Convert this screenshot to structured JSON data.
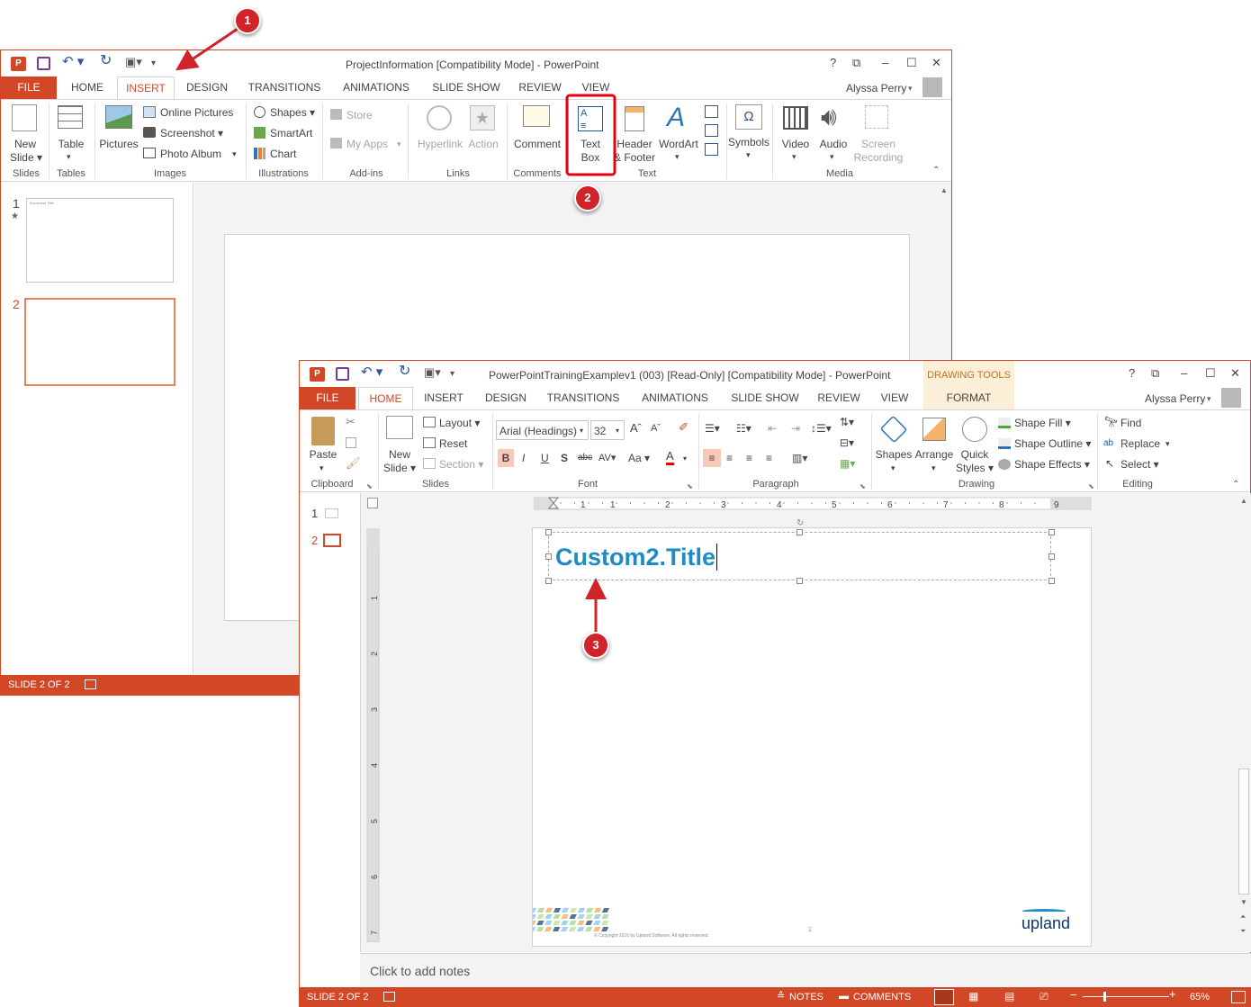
{
  "back": {
    "title": "ProjectInformation [Compatibility Mode] - PowerPoint",
    "tabs": [
      "FILE",
      "HOME",
      "INSERT",
      "DESIGN",
      "TRANSITIONS",
      "ANIMATIONS",
      "SLIDE SHOW",
      "REVIEW",
      "VIEW"
    ],
    "user": "Alyssa Perry",
    "wc": [
      "?",
      "⧉",
      "–",
      "☐",
      "✕"
    ],
    "ribbon": {
      "new_slide": [
        "New",
        "Slide ▾"
      ],
      "table": "Table",
      "pictures": "Pictures",
      "online_pictures": "Online Pictures",
      "screenshot": "Screenshot ▾",
      "photo_album": "Photo Album",
      "shapes": "Shapes ▾",
      "smartart": "SmartArt",
      "chart": "Chart",
      "store": "Store",
      "my_apps": "My Apps",
      "hyperlink": "Hyperlink",
      "action": "Action",
      "comment": "Comment",
      "text_box": [
        "Text",
        "Box"
      ],
      "header_footer": [
        "Header",
        "& Footer"
      ],
      "wordart": "WordArt",
      "symbols": "Symbols",
      "video": "Video",
      "audio": "Audio",
      "screen_recording": [
        "Screen",
        "Recording"
      ],
      "groups": [
        "Slides",
        "Tables",
        "Images",
        "Illustrations",
        "Add-ins",
        "Links",
        "Comments",
        "Text",
        "Media"
      ]
    },
    "thumbs": [
      "1",
      "2"
    ],
    "thumb1_text": "Document Title",
    "status": "SLIDE 2 OF 2"
  },
  "front": {
    "title": "PowerPointTrainingExamplev1 (003) [Read-Only] [Compatibility Mode] - PowerPoint",
    "context": "DRAWING TOOLS",
    "tabs": [
      "FILE",
      "HOME",
      "INSERT",
      "DESIGN",
      "TRANSITIONS",
      "ANIMATIONS",
      "SLIDE SHOW",
      "REVIEW",
      "VIEW",
      "FORMAT"
    ],
    "user": "Alyssa Perry",
    "wc": [
      "?",
      "⧉",
      "–",
      "☐",
      "✕"
    ],
    "ribbon": {
      "paste": "Paste",
      "new_slide": [
        "New",
        "Slide ▾"
      ],
      "layout": "Layout ▾",
      "reset": "Reset",
      "section": "Section ▾",
      "font_name": "Arial (Headings)",
      "font_size": "32",
      "shapes": "Shapes",
      "arrange": "Arrange",
      "quick_styles": [
        "Quick",
        "Styles ▾"
      ],
      "shape_fill": "Shape Fill ▾",
      "shape_outline": "Shape Outline ▾",
      "shape_effects": "Shape Effects ▾",
      "find": "Find",
      "replace": "Replace",
      "select": "Select ▾",
      "groups": [
        "Clipboard",
        "Slides",
        "Font",
        "Paragraph",
        "Drawing",
        "Editing"
      ]
    },
    "thumbs": [
      "1",
      "2"
    ],
    "ruler_h": [
      "2",
      "1",
      "1",
      "2",
      "3",
      "4",
      "5",
      "6",
      "7",
      "8",
      "9"
    ],
    "ruler_v": [
      "1",
      "2",
      "3",
      "4",
      "5",
      "6",
      "7"
    ],
    "slide_title": "Custom2.Title",
    "page_num": "2",
    "copyright": "© Copyright 2016 by Upland Software. All rights reserved.",
    "logo": "upland",
    "notes_placeholder": "Click to add notes",
    "status": "SLIDE 2 OF 2",
    "status_notes": "NOTES",
    "status_comments": "COMMENTS",
    "zoom": "65%"
  },
  "callouts": [
    "1",
    "2",
    "3"
  ],
  "colors": {
    "accent": "#d24726",
    "callout": "#d0232a",
    "title": "#1e8bc3"
  }
}
